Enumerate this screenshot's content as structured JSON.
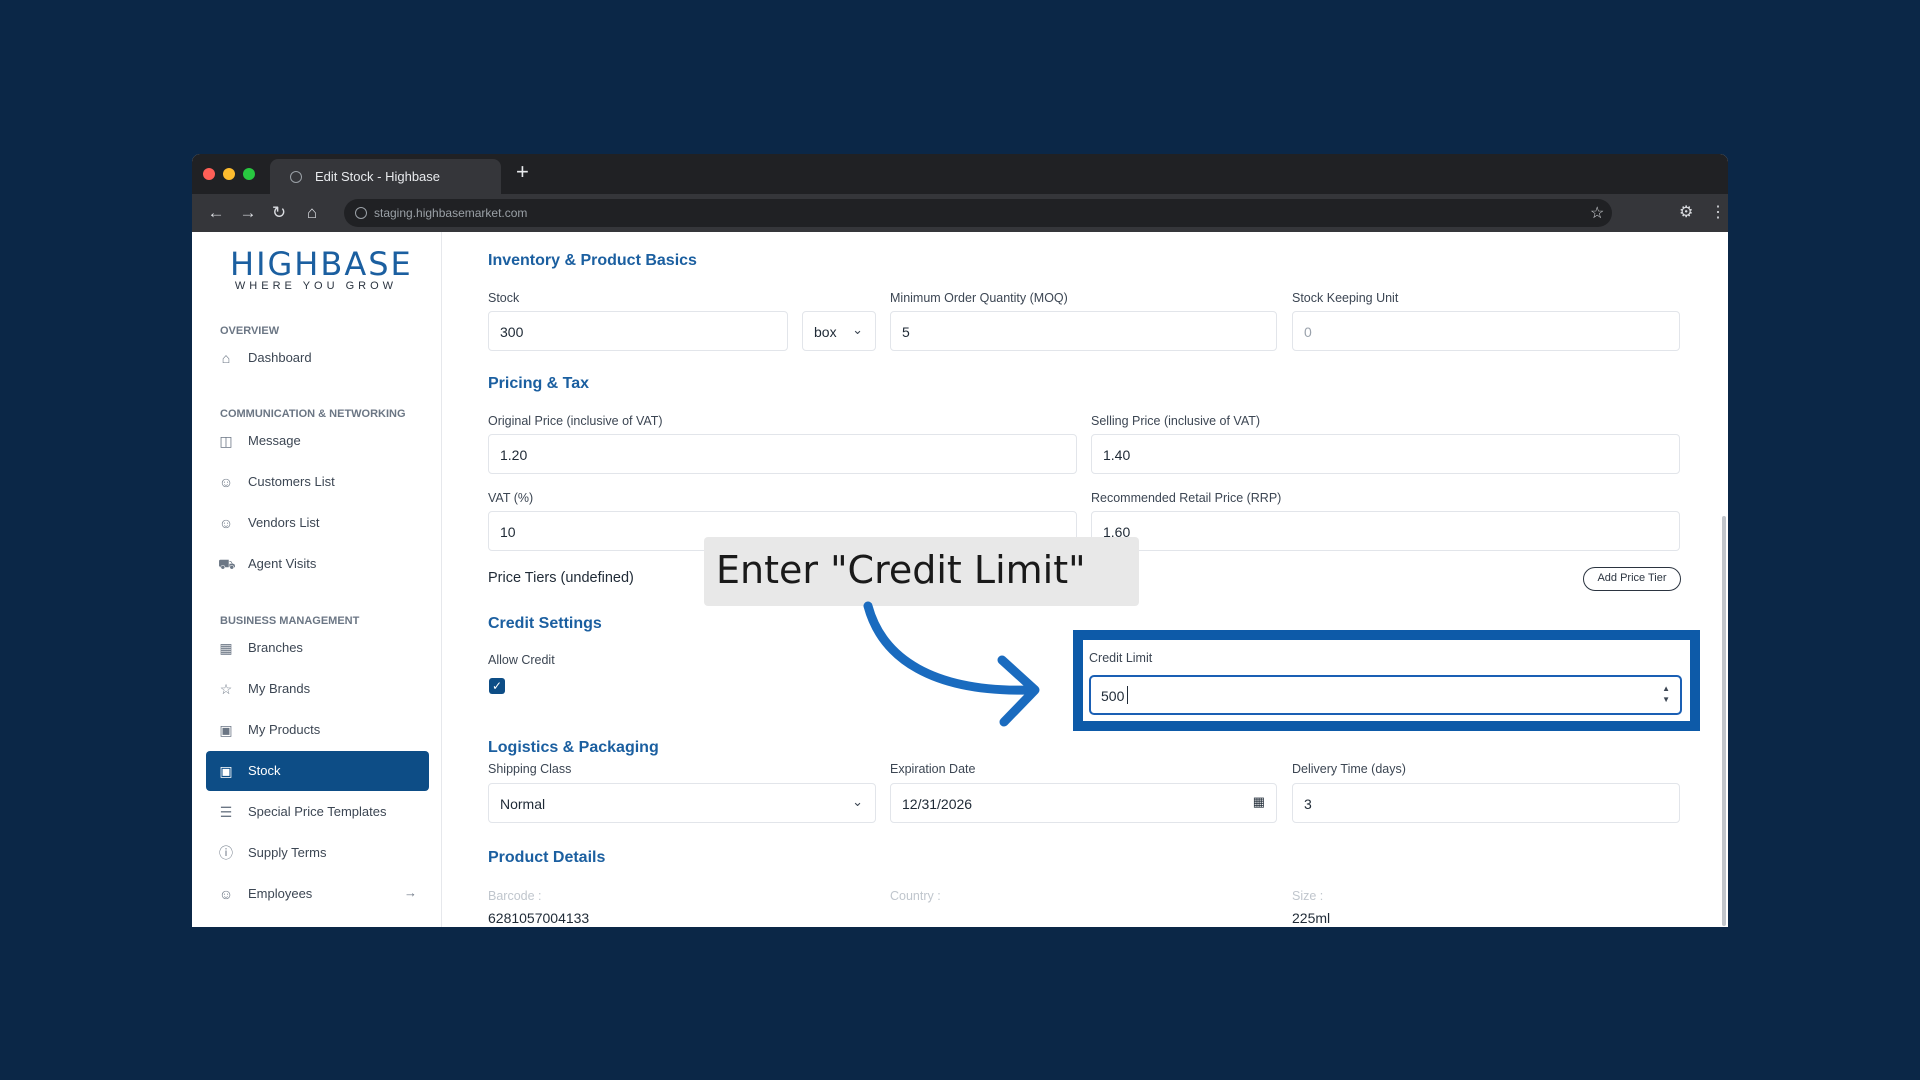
{
  "browser": {
    "tab_title": "Edit Stock - Highbase",
    "new_tab": "+",
    "url": "staging.highbasemarket.com"
  },
  "sidebar": {
    "logo_main": "HIGHBASE",
    "logo_sub": "WHERE YOU GROW",
    "sections": [
      "OVERVIEW",
      "COMMUNICATION & NETWORKING",
      "BUSINESS MANAGEMENT"
    ],
    "items": [
      {
        "label": "Dashboard",
        "icon": "home-icon"
      },
      {
        "label": "Message",
        "icon": "message-icon"
      },
      {
        "label": "Customers List",
        "icon": "users-icon"
      },
      {
        "label": "Vendors List",
        "icon": "users-icon"
      },
      {
        "label": "Agent Visits",
        "icon": "truck-icon"
      },
      {
        "label": "Branches",
        "icon": "store-icon"
      },
      {
        "label": "My Brands",
        "icon": "star-icon"
      },
      {
        "label": "My Products",
        "icon": "box-icon"
      },
      {
        "label": "Stock",
        "icon": "archive-icon",
        "active": true
      },
      {
        "label": "Special Price Templates",
        "icon": "list-icon"
      },
      {
        "label": "Supply Terms",
        "icon": "info-icon"
      },
      {
        "label": "Employees",
        "icon": "employees-icon"
      }
    ]
  },
  "form": {
    "inventory": {
      "title": "Inventory & Product Basics",
      "stock_label": "Stock",
      "stock_value": "300",
      "unit_value": "box",
      "moq_label": "Minimum Order Quantity (MOQ)",
      "moq_value": "5",
      "sku_label": "Stock Keeping Unit",
      "sku_placeholder": "0"
    },
    "pricing": {
      "title": "Pricing & Tax",
      "original_label": "Original Price (inclusive of VAT)",
      "original_value": "1.20",
      "selling_label": "Selling Price (inclusive of VAT)",
      "selling_value": "1.40",
      "vat_label": "VAT (%)",
      "vat_value": "10",
      "rrp_label": "Recommended Retail Price (RRP)",
      "rrp_value": "1.60",
      "tiers_label": "Price Tiers (undefined)",
      "add_tier_button": "Add Price Tier"
    },
    "credit": {
      "title": "Credit Settings",
      "allow_label": "Allow Credit",
      "allow_checked": true,
      "limit_label": "Credit Limit",
      "limit_value": "500"
    },
    "logistics": {
      "title": "Logistics & Packaging",
      "shipping_label": "Shipping Class",
      "shipping_value": "Normal",
      "expiration_label": "Expiration Date",
      "expiration_value": "12/31/2026",
      "delivery_label": "Delivery Time (days)",
      "delivery_value": "3"
    },
    "product_details": {
      "title": "Product Details",
      "barcode_label": "Barcode :",
      "barcode_value": "6281057004133",
      "country_label": "Country :",
      "size_label": "Size :",
      "size_value": "225ml"
    }
  },
  "callout": {
    "text": "Enter \"Credit Limit\""
  },
  "colors": {
    "background": "#0b2747",
    "brand": "#1b5fa0",
    "active_nav": "#0d4d86",
    "highlight": "#0d5aa8"
  }
}
